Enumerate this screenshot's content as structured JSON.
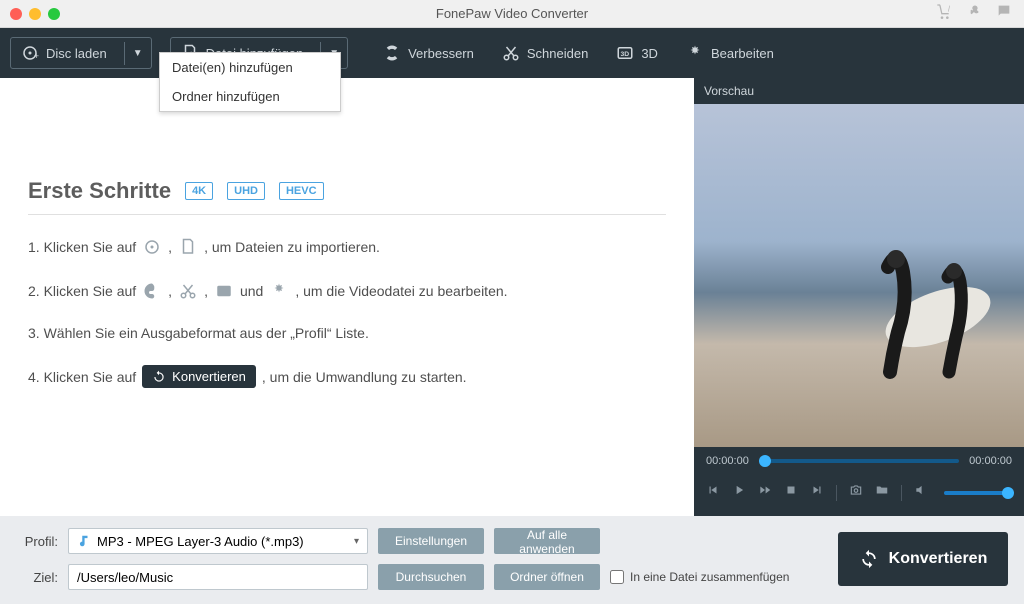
{
  "window": {
    "title": "FonePaw Video Converter"
  },
  "toolbar": {
    "disc_load": "Disc laden",
    "add_file": "Datei hinzufügen",
    "enhance": "Verbessern",
    "cut": "Schneiden",
    "three_d": "3D",
    "edit": "Bearbeiten"
  },
  "dropdown": {
    "add_files": "Datei(en) hinzufügen",
    "add_folder": "Ordner hinzufügen"
  },
  "getting_started": {
    "title": "Erste Schritte",
    "badges": [
      "4K",
      "UHD",
      "HEVC"
    ],
    "step1a": "1. Klicken Sie auf",
    "step1b": ", um Dateien zu importieren.",
    "step2a": "2. Klicken Sie auf",
    "step2_und": "und",
    "step2b": ", um die Videodatei zu bearbeiten.",
    "step3": "3. Wählen Sie ein Ausgabeformat aus der „Profil“ Liste.",
    "step4a": "4. Klicken Sie auf",
    "step4_chip": "Konvertieren",
    "step4b": ", um die Umwandlung zu starten."
  },
  "preview": {
    "title": "Vorschau",
    "time_current": "00:00:00",
    "time_total": "00:00:00"
  },
  "footer": {
    "profile_label": "Profil:",
    "profile_value": "MP3 - MPEG Layer-3 Audio (*.mp3)",
    "settings": "Einstellungen",
    "apply_all": "Auf alle anwenden",
    "dest_label": "Ziel:",
    "dest_value": "/Users/leo/Music",
    "browse": "Durchsuchen",
    "open_folder": "Ordner öffnen",
    "merge": "In eine Datei zusammenfügen",
    "convert": "Konvertieren"
  }
}
